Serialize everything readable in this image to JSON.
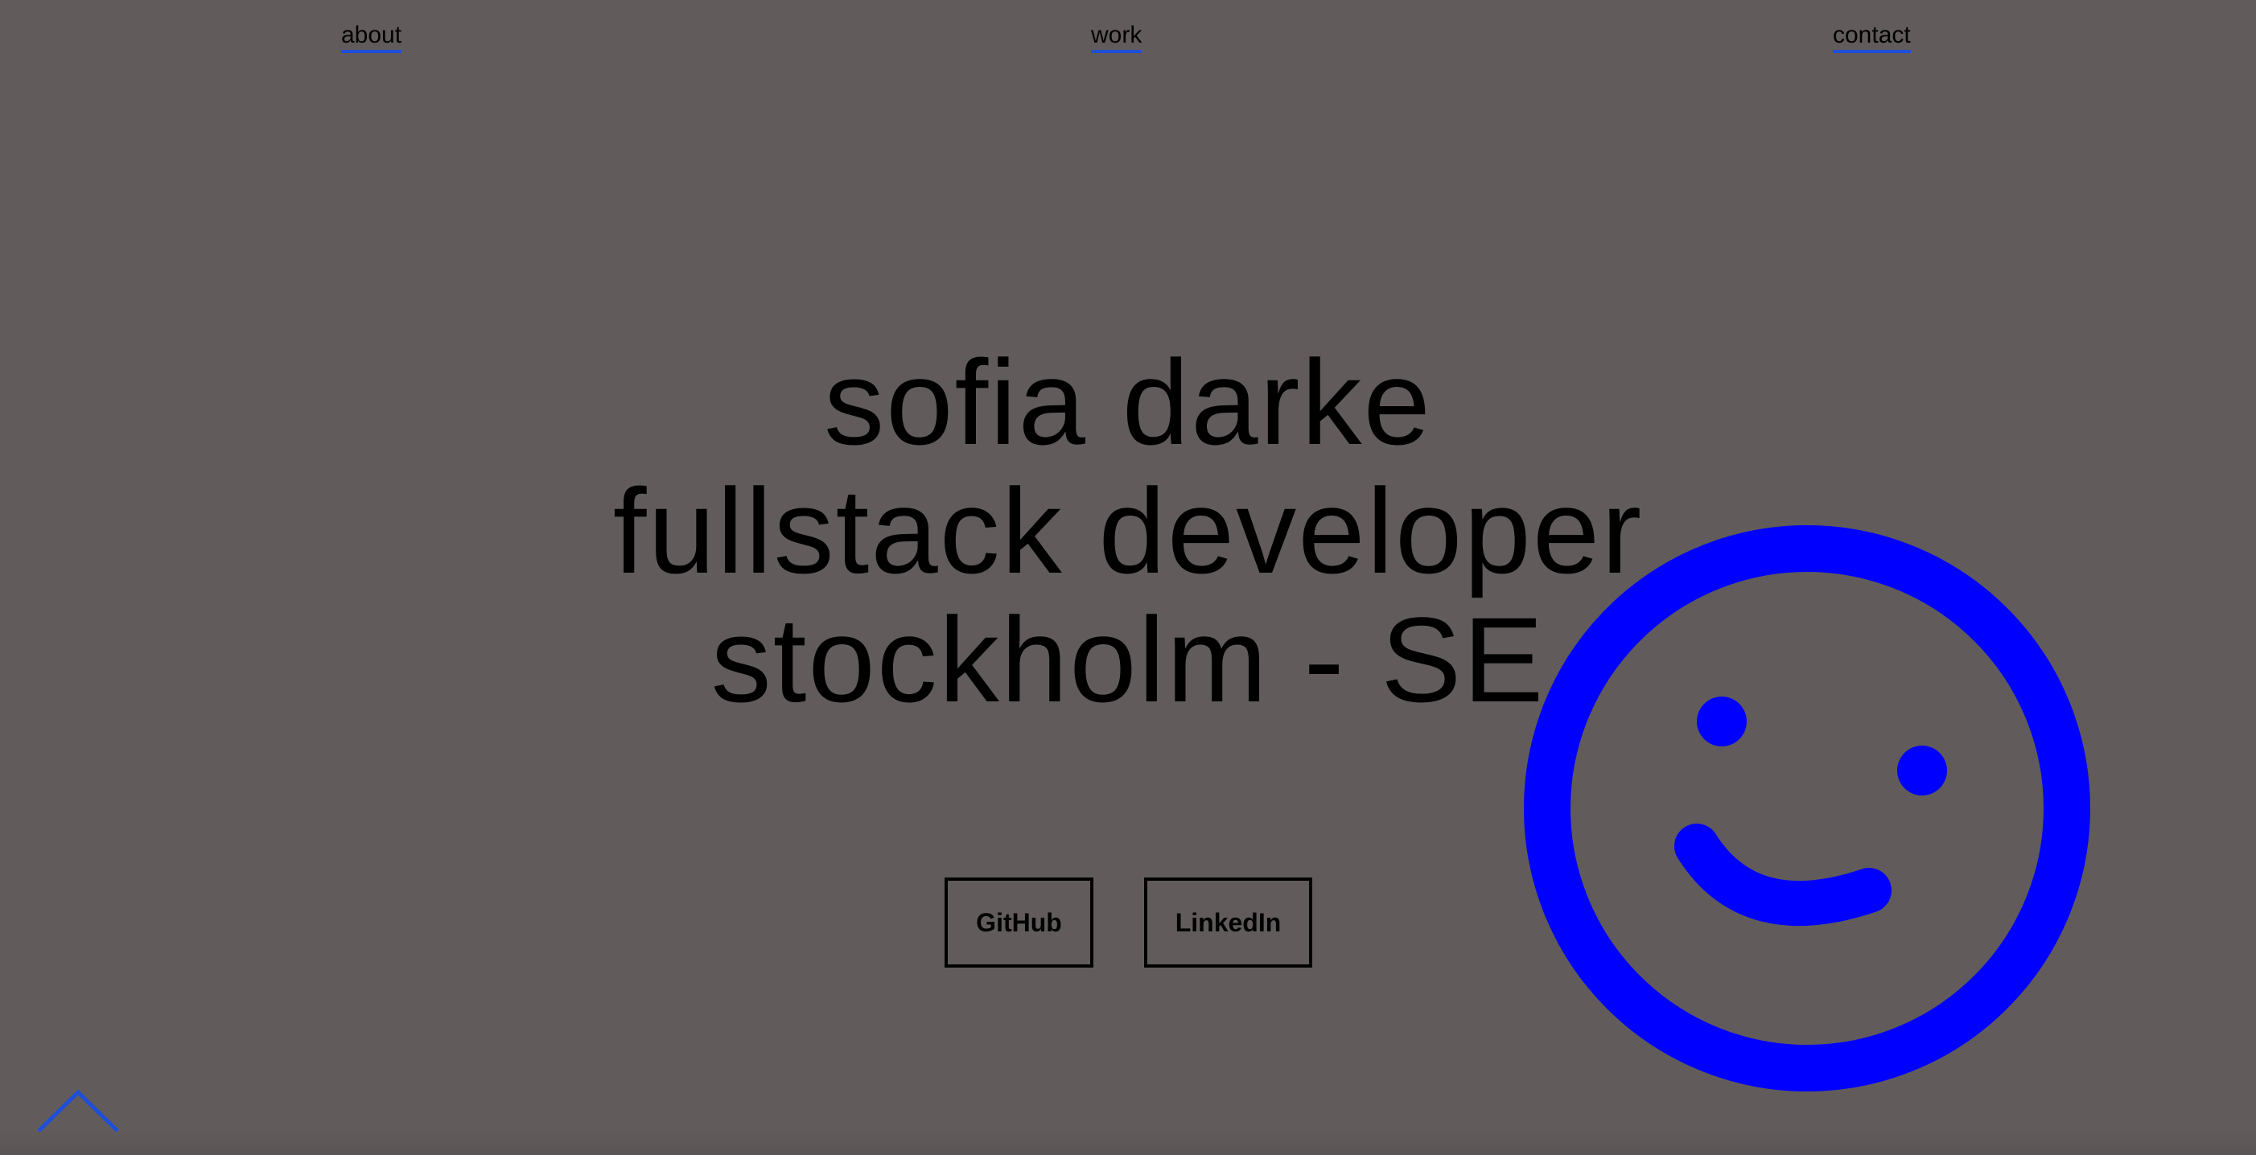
{
  "nav": {
    "about": "about",
    "work": "work",
    "contact": "contact"
  },
  "hero": {
    "name": "sofia darke",
    "role": "fullstack developer",
    "location": "stockholm - SE"
  },
  "buttons": {
    "github": "GitHub",
    "linkedin": "LinkedIn"
  },
  "icons": {
    "smiley": "smiley-face-icon",
    "scroll_top": "chevron-up-icon"
  },
  "colors": {
    "background": "#615b5b",
    "accent": "#0000ff",
    "link_underline": "#1f4fd8",
    "text": "#000000"
  }
}
